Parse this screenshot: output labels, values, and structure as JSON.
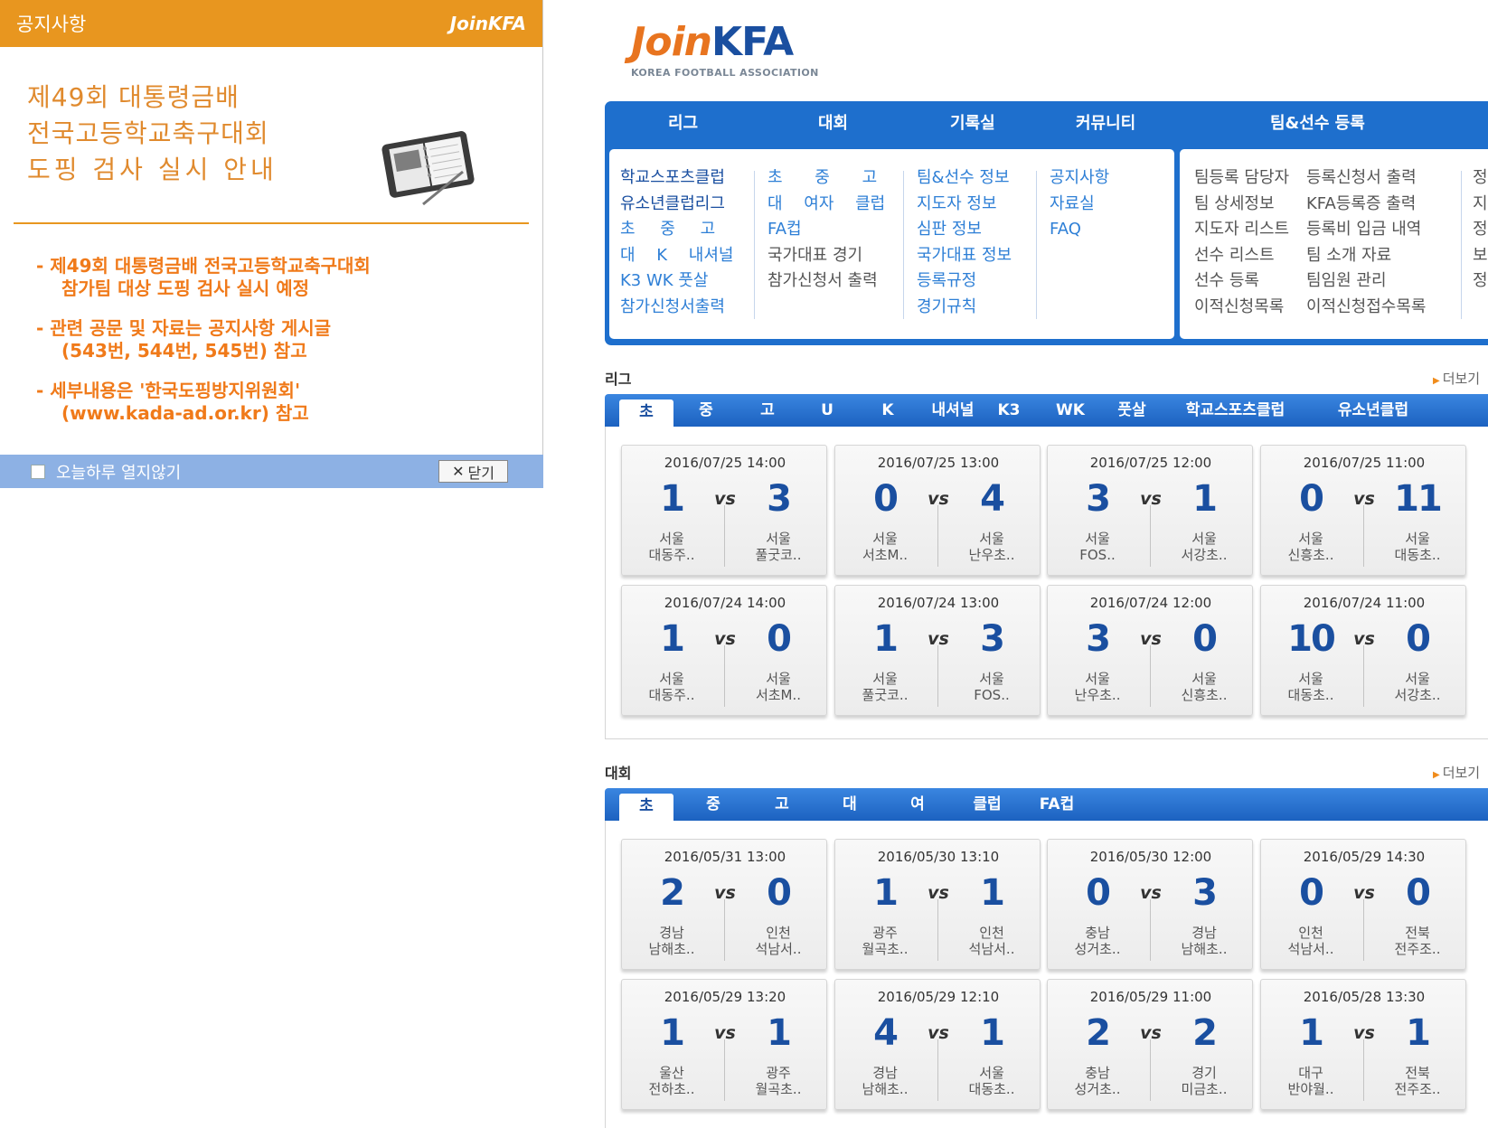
{
  "popup": {
    "header_title": "공지사항",
    "brand": "JoinKFA",
    "heading": [
      "제49회 대통령금배",
      "전국고등학교축구대회",
      "도핑 검사 실시 안내"
    ],
    "bullets": [
      [
        "- 제49회 대통령금배 전국고등학교축구대회",
        "참가팀 대상 도핑 검사 실시 예정"
      ],
      [
        "- 관련 공문 및 자료는 공지사항 게시글",
        "(543번, 544번, 545번) 참고"
      ],
      [
        "- 세부내용은 '한국도핑방지위원회'",
        "(www.kada-ad.or.kr) 참고"
      ]
    ],
    "checkbox_label": "오늘하루 열지않기",
    "close_label": "닫기"
  },
  "logo": {
    "join": "Join",
    "kfa": "KFA",
    "sub": "KOREA FOOTBALL ASSOCIATION"
  },
  "menu": {
    "tabs": [
      "리그",
      "대회",
      "기록실",
      "커뮤니티",
      "팀&선수 등록"
    ],
    "league_items": [
      "학교스포츠클럽",
      "유소년클럽리그",
      "초 중 고",
      "대 K 내셔널",
      "K3 WK 풋살",
      "참가신청서출력"
    ],
    "competition_items": [
      "초 중 고",
      "대 여자 클럽",
      "FA컵",
      "국가대표 경기",
      "참가신청서 출력"
    ],
    "record_items": [
      "팀&선수 정보",
      "지도자 정보",
      "심판 정보",
      "국가대표 정보",
      "등록규정",
      "경기규칙"
    ],
    "community_items": [
      "공지사항",
      "자료실",
      "FAQ"
    ],
    "register_col1": [
      "팀등록 담당자",
      "팀 상세정보",
      "지도자 리스트",
      "선수 리스트",
      "선수 등록",
      "이적신청목록"
    ],
    "register_col2": [
      "등록신청서 출력",
      "KFA등록증 출력",
      "등록비 입금 내역",
      "팀 소개 자료",
      "팀임원 관리",
      "이적신청접수목록"
    ],
    "register_col3": [
      "정",
      "지",
      "정",
      "보",
      "정"
    ]
  },
  "league": {
    "title": "리그",
    "more": "더보기",
    "tabs": [
      "초",
      "중",
      "고",
      "U",
      "K",
      "내셔널",
      "K3",
      "WK",
      "풋살",
      "학교스포츠클럽",
      "유소년클럽"
    ],
    "matches": [
      {
        "date": "2016/07/25 14:00",
        "home_score": "1",
        "away_score": "3",
        "home_region": "서울",
        "home_team": "대동주..",
        "away_region": "서울",
        "away_team": "풀굿코.."
      },
      {
        "date": "2016/07/25 13:00",
        "home_score": "0",
        "away_score": "4",
        "home_region": "서울",
        "home_team": "서초M..",
        "away_region": "서울",
        "away_team": "난우초.."
      },
      {
        "date": "2016/07/25 12:00",
        "home_score": "3",
        "away_score": "1",
        "home_region": "서울",
        "home_team": "FOS..",
        "away_region": "서울",
        "away_team": "서강초.."
      },
      {
        "date": "2016/07/25 11:00",
        "home_score": "0",
        "away_score": "11",
        "home_region": "서울",
        "home_team": "신흥초..",
        "away_region": "서울",
        "away_team": "대동초.."
      },
      {
        "date": "2016/07/24 14:00",
        "home_score": "1",
        "away_score": "0",
        "home_region": "서울",
        "home_team": "대동주..",
        "away_region": "서울",
        "away_team": "서초M.."
      },
      {
        "date": "2016/07/24 13:00",
        "home_score": "1",
        "away_score": "3",
        "home_region": "서울",
        "home_team": "풀굿코..",
        "away_region": "서울",
        "away_team": "FOS.."
      },
      {
        "date": "2016/07/24 12:00",
        "home_score": "3",
        "away_score": "0",
        "home_region": "서울",
        "home_team": "난우초..",
        "away_region": "서울",
        "away_team": "신흥초.."
      },
      {
        "date": "2016/07/24 11:00",
        "home_score": "10",
        "away_score": "0",
        "home_region": "서울",
        "home_team": "대동초..",
        "away_region": "서울",
        "away_team": "서강초.."
      }
    ]
  },
  "competition": {
    "title": "대회",
    "more": "더보기",
    "tabs": [
      "초",
      "중",
      "고",
      "대",
      "여",
      "클럽",
      "FA컵"
    ],
    "matches": [
      {
        "date": "2016/05/31 13:00",
        "home_score": "2",
        "away_score": "0",
        "home_region": "경남",
        "home_team": "남해초..",
        "away_region": "인천",
        "away_team": "석남서.."
      },
      {
        "date": "2016/05/30 13:10",
        "home_score": "1",
        "away_score": "1",
        "home_region": "광주",
        "home_team": "월곡초..",
        "away_region": "인천",
        "away_team": "석남서.."
      },
      {
        "date": "2016/05/30 12:00",
        "home_score": "0",
        "away_score": "3",
        "home_region": "충남",
        "home_team": "성거초..",
        "away_region": "경남",
        "away_team": "남해초.."
      },
      {
        "date": "2016/05/29 14:30",
        "home_score": "0",
        "away_score": "0",
        "home_region": "인천",
        "home_team": "석남서..",
        "away_region": "전북",
        "away_team": "전주조.."
      },
      {
        "date": "2016/05/29 13:20",
        "home_score": "1",
        "away_score": "1",
        "home_region": "울산",
        "home_team": "전하초..",
        "away_region": "광주",
        "away_team": "월곡초.."
      },
      {
        "date": "2016/05/29 12:10",
        "home_score": "4",
        "away_score": "1",
        "home_region": "경남",
        "home_team": "남해초..",
        "away_region": "서울",
        "away_team": "대동초.."
      },
      {
        "date": "2016/05/29 11:00",
        "home_score": "2",
        "away_score": "2",
        "home_region": "충남",
        "home_team": "성거초..",
        "away_region": "경기",
        "away_team": "미금초.."
      },
      {
        "date": "2016/05/28 13:30",
        "home_score": "1",
        "away_score": "1",
        "home_region": "대구",
        "home_team": "반야월..",
        "away_region": "전북",
        "away_team": "전주조.."
      }
    ]
  }
}
